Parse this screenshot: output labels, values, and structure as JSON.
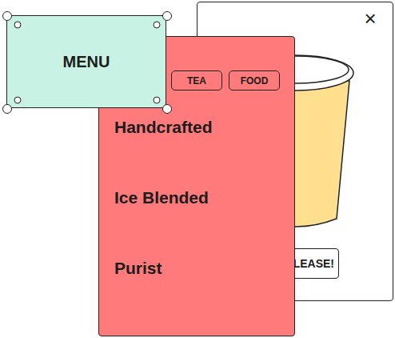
{
  "back_window": {
    "close": "×",
    "button": "LEASE!"
  },
  "menu_panel": {
    "tags": [
      "TEA",
      "FOOD"
    ],
    "items": [
      "Handcrafted",
      "Ice Blended",
      "Purist"
    ]
  },
  "label": {
    "text": "MENU",
    "selected": true
  }
}
